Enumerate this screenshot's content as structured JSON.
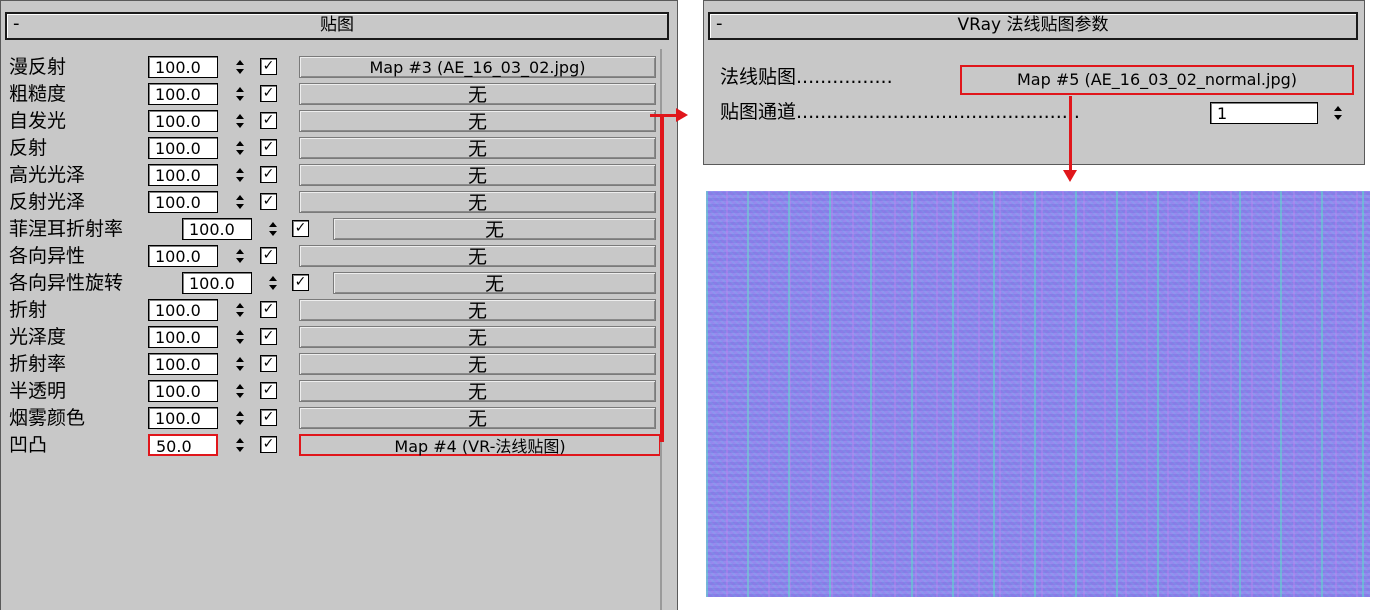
{
  "maps_panel": {
    "collapse": "-",
    "title": "贴图",
    "rows": [
      {
        "label": "漫反射",
        "value": "100.0",
        "map": "Map #3 (AE_16_03_02.jpg)"
      },
      {
        "label": "粗糙度",
        "value": "100.0",
        "map": "无"
      },
      {
        "label": "自发光",
        "value": "100.0",
        "map": "无"
      },
      {
        "label": "反射",
        "value": "100.0",
        "map": "无"
      },
      {
        "label": "高光光泽",
        "value": "100.0",
        "map": "无"
      },
      {
        "label": "反射光泽",
        "value": "100.0",
        "map": "无"
      },
      {
        "label": "菲涅耳折射率",
        "value": "100.0",
        "map": "无"
      },
      {
        "label": "各向异性",
        "value": "100.0",
        "map": "无"
      },
      {
        "label": "各向异性旋转",
        "value": "100.0",
        "map": "无"
      },
      {
        "label": "折射",
        "value": "100.0",
        "map": "无"
      },
      {
        "label": "光泽度",
        "value": "100.0",
        "map": "无"
      },
      {
        "label": "折射率",
        "value": "100.0",
        "map": "无"
      },
      {
        "label": "半透明",
        "value": "100.0",
        "map": "无"
      },
      {
        "label": "烟雾颜色",
        "value": "100.0",
        "map": "无"
      },
      {
        "label": "凹凸",
        "value": "50.0",
        "map": "Map #4 (VR-法线贴图)"
      }
    ]
  },
  "normal_panel": {
    "collapse": "-",
    "title": "VRay 法线贴图参数",
    "normal_map_label": "法线贴图................",
    "normal_map_value": "Map #5 (AE_16_03_02_normal.jpg)",
    "channel_label": "贴图通道...............................................",
    "channel_value": "1"
  },
  "colors": {
    "highlight": "#e0161b",
    "panel_bg": "#c8c8c8"
  }
}
